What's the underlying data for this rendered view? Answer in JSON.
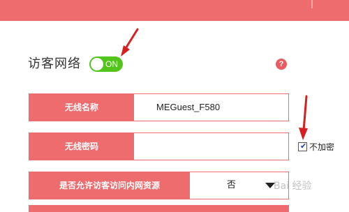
{
  "guest_network": {
    "title": "访客网络",
    "toggle_label": "ON",
    "enabled": true,
    "help_icon_glyph": "?"
  },
  "form": {
    "ssid": {
      "label": "无线名称",
      "value": "MEGuest_F580"
    },
    "password": {
      "label": "无线密码",
      "value": ""
    },
    "no_encrypt": {
      "label": "不加密",
      "checked": true
    },
    "intranet_access": {
      "label": "是否允许访客访问内网资源",
      "value": "否"
    }
  },
  "watermark": {
    "text": "Bai 经验"
  },
  "icons": {
    "help": "question-circle-icon",
    "dropdown": "caret-down-icon",
    "checkbox": "check-icon",
    "annotation": "arrow-annotation-icon"
  },
  "colors": {
    "brand": "#ee6b6e",
    "toggle_on": "#52c41a",
    "arrow": "#d62020",
    "help_icon": "#e85c5f"
  }
}
